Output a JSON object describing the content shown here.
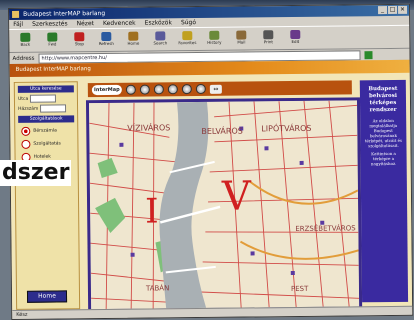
{
  "window": {
    "title": "Budapest InterMAP barlang",
    "controls": [
      "_",
      "□",
      "×"
    ]
  },
  "menu": [
    "Fájl",
    "Szerkesztés",
    "Nézet",
    "Kedvencek",
    "Eszközök",
    "Súgó"
  ],
  "toolbar": [
    {
      "label": "Back",
      "icon": "back-arrow-icon",
      "color": "#2a7a2a"
    },
    {
      "label": "Fwd",
      "icon": "forward-arrow-icon",
      "color": "#2a7a2a"
    },
    {
      "label": "Stop",
      "icon": "stop-icon",
      "color": "#c02020"
    },
    {
      "label": "Refresh",
      "icon": "refresh-icon",
      "color": "#2a5aa0"
    },
    {
      "label": "Home",
      "icon": "home-icon",
      "color": "#a07020"
    },
    {
      "label": "Search",
      "icon": "search-icon",
      "color": "#5a5a9a"
    },
    {
      "label": "Favorites",
      "icon": "favorites-icon",
      "color": "#c0a020"
    },
    {
      "label": "History",
      "icon": "history-icon",
      "color": "#6a8a3a"
    },
    {
      "label": "Mail",
      "icon": "mail-icon",
      "color": "#8a6a3a"
    },
    {
      "label": "Print",
      "icon": "print-icon",
      "color": "#555"
    },
    {
      "label": "Edit",
      "icon": "edit-icon",
      "color": "#6a3a8a"
    }
  ],
  "address": {
    "label": "Address",
    "value": "http://www.mapcentre.hu/"
  },
  "site": {
    "header_text": "Budapest InterMAP barlang",
    "header_accent": "InterMAP"
  },
  "left_panel": {
    "search_heading": "Utca keresése",
    "fields": [
      {
        "label": "Utca"
      },
      {
        "label": "Házszám"
      }
    ],
    "layers_heading": "Szolgáltatások",
    "radios": [
      {
        "label": "Bérszámla",
        "selected": true
      },
      {
        "label": "Szolgáltatás",
        "selected": false
      },
      {
        "label": "Hotelek",
        "selected": false
      }
    ],
    "home_button": "Home"
  },
  "map": {
    "logo": "InterMap",
    "districts": [
      "VÍZIVÁROS",
      "BELVÁROS",
      "LIPÓTVÁROS",
      "ERZSÉBETVÁROS",
      "TABÁN",
      "PEST"
    ],
    "district_numbers": [
      "I",
      "V"
    ],
    "river_color": "#a9b0b4",
    "street_color": "#cc3030",
    "park_color": "#7fc07a"
  },
  "right_panel": {
    "title": "Budapest belvárosi térképes rendszer",
    "text": "Az oldalon megtalálhatja Budapest belvárosának térképét, utcáit és szolgáltatásait.",
    "text2": "Kattintson a térképre a nagyításhoz."
  },
  "overlay": {
    "text": "dszer"
  },
  "status": {
    "text": "Kész"
  }
}
